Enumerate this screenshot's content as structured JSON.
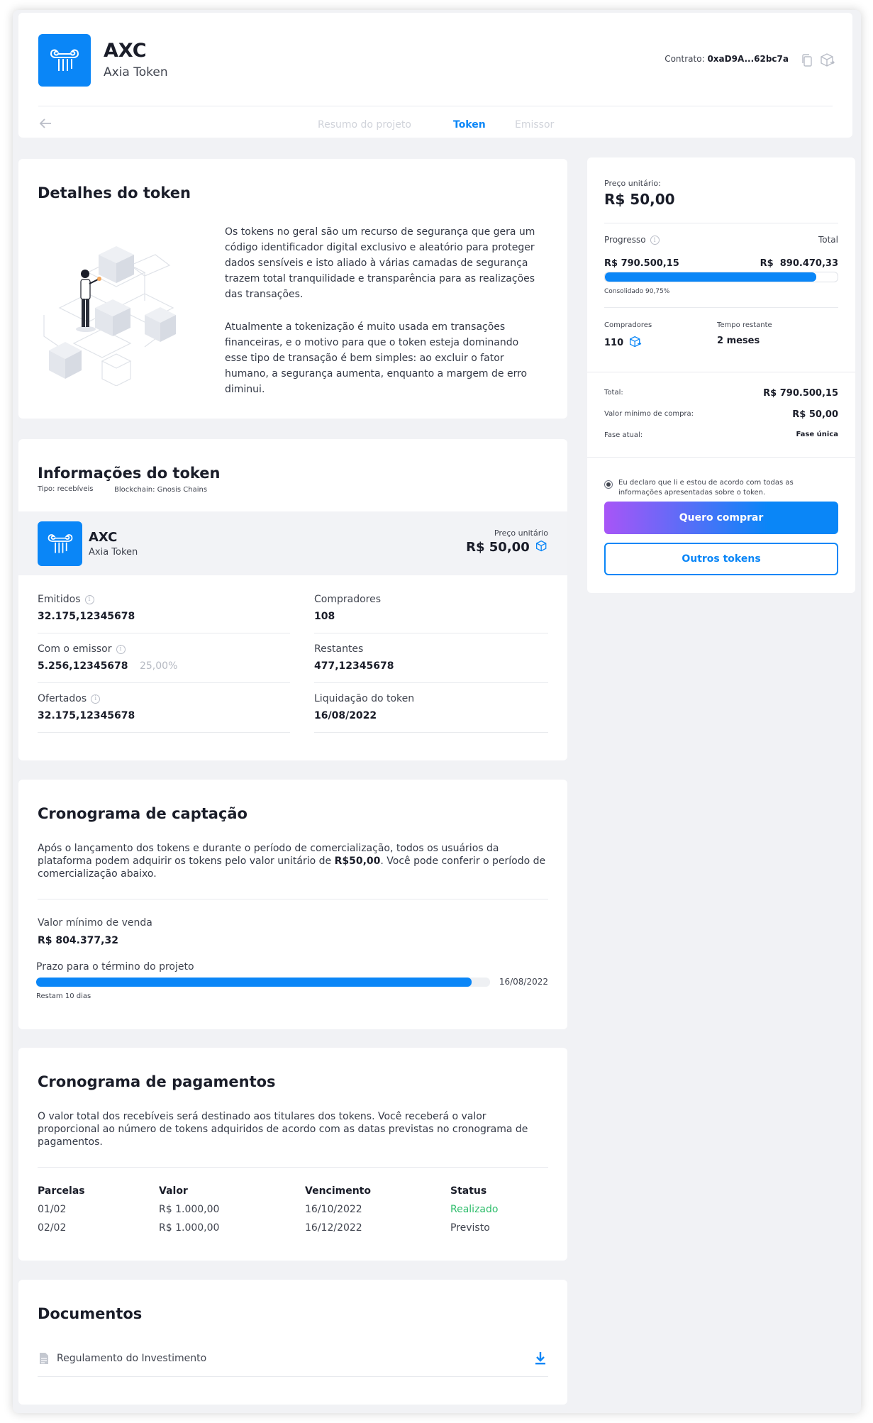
{
  "header": {
    "symbol": "AXC",
    "name": "Axia Token",
    "contract_label": "Contrato:",
    "contract_address": "0xaD9A...62bc7a",
    "tabs": [
      {
        "label": "Resumo do projeto",
        "active": false
      },
      {
        "label": "Token",
        "active": true
      },
      {
        "label": "Emissor",
        "active": false
      }
    ]
  },
  "details": {
    "title": "Detalhes do token",
    "paragraph1": "Os tokens no geral são um recurso de segurança que gera um código identificador digital exclusivo e aleatório para proteger dados sensíveis e isto aliado à várias camadas de segurança trazem total tranquilidade e transparência para as realizações das transações.",
    "paragraph2": "Atualmente a tokenização é muito usada em transações financeiras, e o motivo para que o token esteja dominando esse tipo de transação é bem simples: ao excluir o fator humano, a segurança aumenta, enquanto a margem de erro diminui."
  },
  "info": {
    "title": "Informações do token",
    "type": "Tipo: recebíveis",
    "blockchain": "Blockchain: Gnosis Chains",
    "token_symbol": "AXC",
    "token_name": "Axia Token",
    "price_label": "Preço unitário",
    "price_value": "R$ 50,00",
    "fields": {
      "emitidos_label": "Emitidos",
      "emitidos_value": "32.175,12345678",
      "compradores_label": "Compradores",
      "compradores_value": "108",
      "emissor_label": "Com o emissor",
      "emissor_value": "5.256,12345678",
      "emissor_pct": "25,00%",
      "restantes_label": "Restantes",
      "restantes_value": "477,12345678",
      "ofertados_label": "Ofertados",
      "ofertados_value": "32.175,12345678",
      "liquidacao_label": "Liquidação do token",
      "liquidacao_value": "16/08/2022"
    }
  },
  "captacao": {
    "title": "Cronograma de captação",
    "text_before": "Após o lançamento dos tokens e durante o período de comercialização, todos os usuários da plataforma podem adquirir os tokens pelo valor unitário de ",
    "text_bold": "R$50,00",
    "text_after": ". Você pode conferir o período de comercialização abaixo.",
    "min_label": "Valor mínimo de venda",
    "min_value": "R$ 804.377,32",
    "deadline_label": "Prazo para o término do projeto",
    "deadline_date": "16/08/2022",
    "remaining": "Restam 10 dias",
    "progress": 0.96
  },
  "pagamentos": {
    "title": "Cronograma de pagamentos",
    "text": "O valor total dos recebíveis será destinado aos titulares dos tokens. Você receberá o valor proporcional ao número de tokens adquiridos de acordo com as datas previstas no cronograma de pagamentos.",
    "headers": [
      "Parcelas",
      "Valor",
      "Vencimento",
      "Status"
    ],
    "rows": [
      [
        "01/02",
        "R$ 1.000,00",
        "16/10/2022",
        "Realizado"
      ],
      [
        "02/02",
        "R$ 1.000,00",
        "16/12/2022",
        "Previsto"
      ]
    ],
    "colors": {
      "realizado": "#2ebd6b"
    }
  },
  "documentos": {
    "title": "Documentos",
    "items": [
      {
        "label": "Regulamento do Investimento"
      }
    ]
  },
  "sidebar": {
    "price_label": "Preço unitário:",
    "price_value": "R$ 50,00",
    "progress_label": "Progresso",
    "total_label": "Total",
    "progress_value": "R$ 790.500,15",
    "total_value": "R$  890.470,33",
    "consolidated": "Consolidado 90,75%",
    "progress": 0.9075,
    "buyers_label": "Compradores",
    "buyers_value": "110",
    "time_label": "Tempo restante",
    "time_value": "2 meses",
    "summary": [
      {
        "label": "Total:",
        "value": "R$ 790.500,15"
      },
      {
        "label": "Valor mínimo de compra:",
        "value": "R$ 50,00"
      },
      {
        "label": "Fase atual:",
        "value": "Fase única"
      }
    ],
    "declaration": "Eu declaro que li e estou de acordo com todas as informações apresentadas sobre o token.",
    "buy_button": "Quero comprar",
    "other_button": "Outros tokens"
  },
  "colors": {
    "accent": "#0a86f7",
    "gradient_start": "#a855f7",
    "gradient_end": "#0a86f7"
  }
}
